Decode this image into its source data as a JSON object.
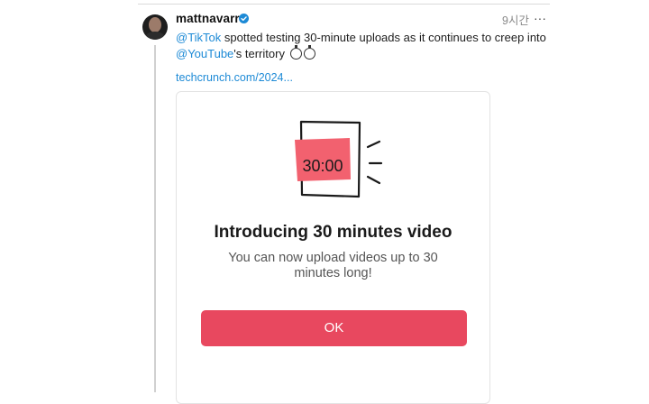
{
  "post": {
    "username": "mattnavarra",
    "time": "9시간",
    "more": "···",
    "mention_tiktok": "@TikTok",
    "text_part1": " spotted testing 30-minute uploads as it continues to creep into ",
    "mention_youtube": "@YouTube",
    "text_part2": "'s territory",
    "emoji": "stopwatch-icon",
    "link": "techcrunch.com/2024..."
  },
  "card": {
    "timer": "30:00",
    "title": "Introducing 30 minutes video",
    "description": "You can now upload videos up to 30 minutes long!",
    "button": "OK"
  },
  "colors": {
    "accent_link": "#1d8ad6",
    "button_red": "#e8485f",
    "verified_blue": "#1d8ad6"
  }
}
